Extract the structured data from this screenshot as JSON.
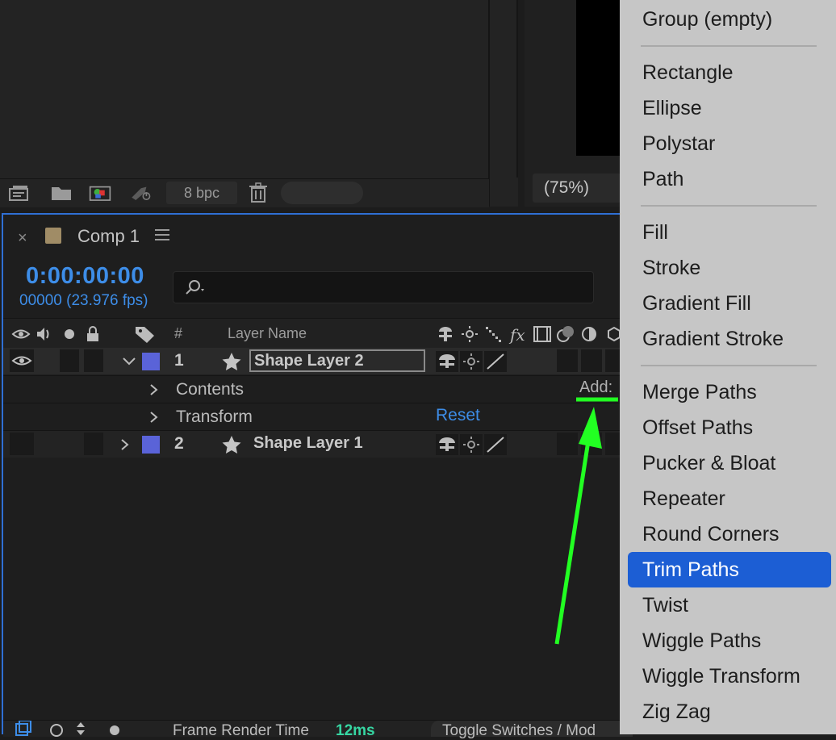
{
  "project_panel": {
    "bit_depth": "8 bpc",
    "zoom": "(75%)"
  },
  "timeline": {
    "tab_title": "Comp 1",
    "tab_close": "×",
    "timecode": "0:00:00:00",
    "fps": "00000 (23.976 fps)",
    "columns": {
      "number": "#",
      "layer_name": "Layer Name"
    },
    "layers": [
      {
        "index": "1",
        "name": "Shape Layer 2",
        "color": "#5a63d8"
      },
      {
        "index": "2",
        "name": "Shape Layer 1",
        "color": "#5a63d8"
      }
    ],
    "sub_rows": {
      "contents": "Contents",
      "transform": "Transform",
      "reset": "Reset",
      "add": "Add:"
    },
    "footer": {
      "render_label": "Frame Render Time",
      "render_value": "12ms",
      "toggle": "Toggle Switches / Mod"
    }
  },
  "menu": {
    "group_empty": "Group (empty)",
    "shapes": [
      "Rectangle",
      "Ellipse",
      "Polystar",
      "Path"
    ],
    "fills": [
      "Fill",
      "Stroke",
      "Gradient Fill",
      "Gradient Stroke"
    ],
    "modifiers": [
      "Merge Paths",
      "Offset Paths",
      "Pucker & Bloat",
      "Repeater",
      "Round Corners",
      "Trim Paths",
      "Twist",
      "Wiggle Paths",
      "Wiggle Transform",
      "Zig Zag"
    ],
    "selected": "Trim Paths",
    "highlight_color": "#1c5ed4"
  },
  "annotation_color": "#22ff22"
}
